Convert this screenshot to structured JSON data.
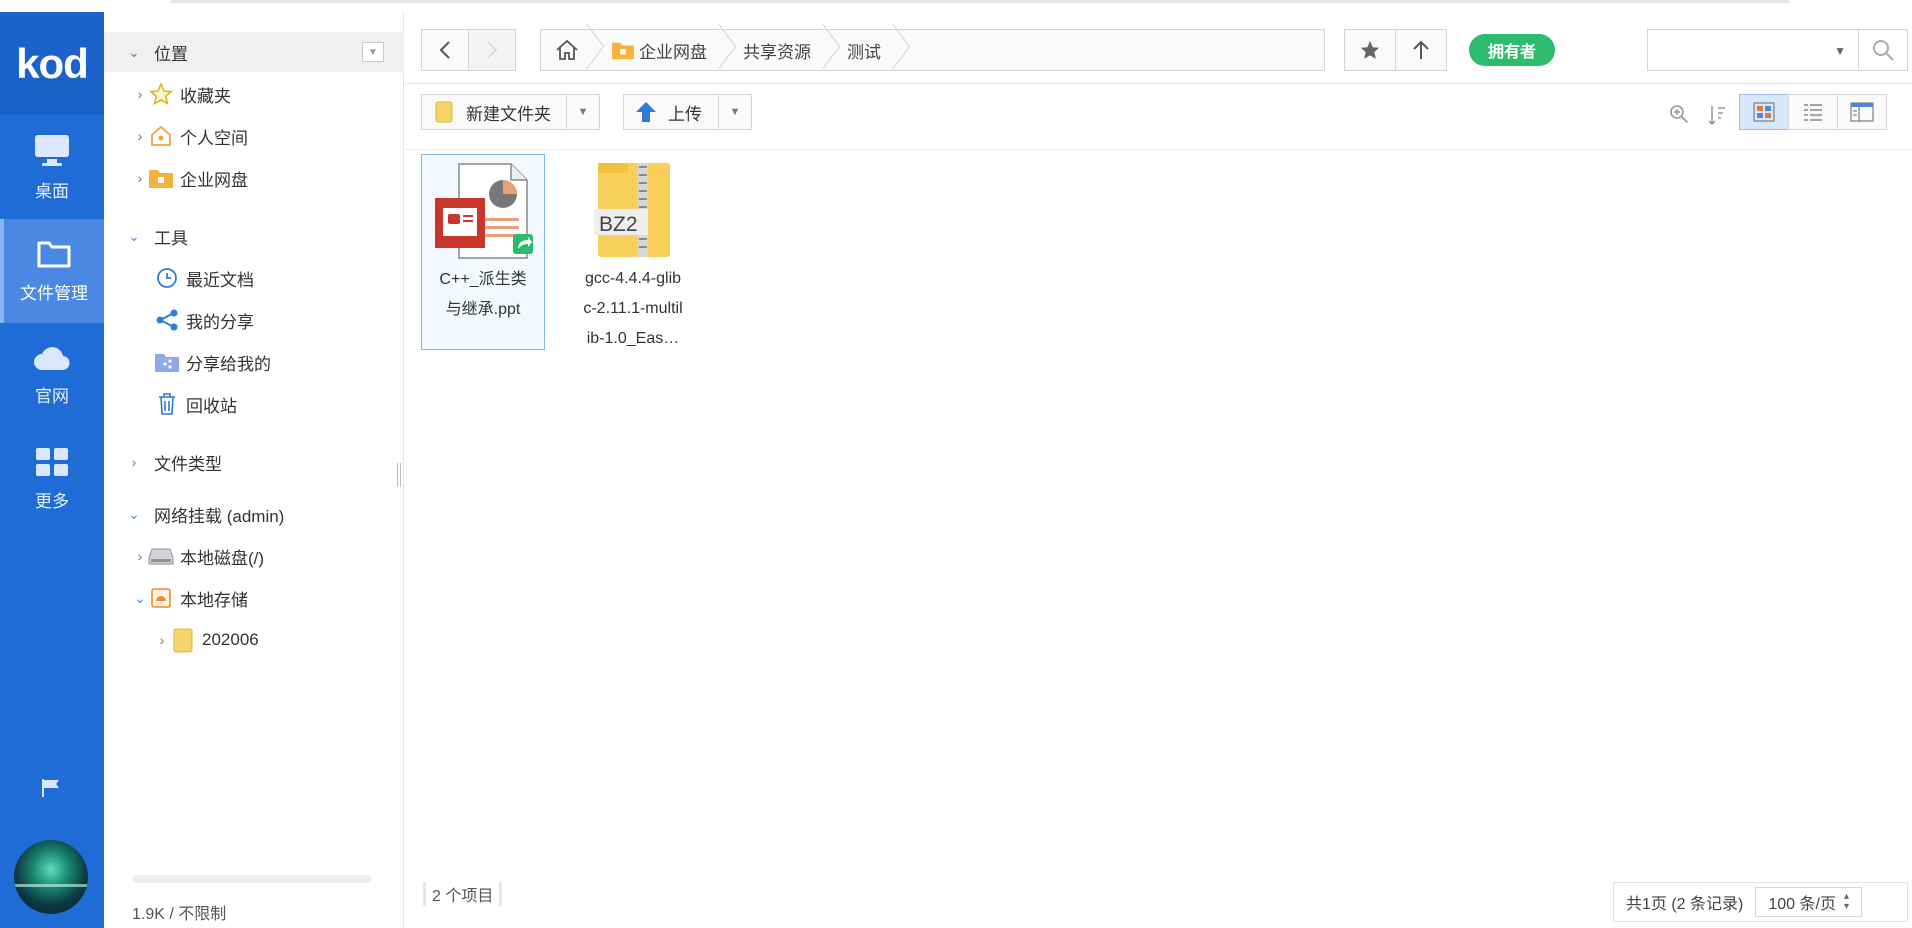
{
  "app": {
    "logo": "kod"
  },
  "leftnav": {
    "items": [
      {
        "label": "桌面",
        "icon": "monitor-icon"
      },
      {
        "label": "文件管理",
        "icon": "folder-icon",
        "active": true
      },
      {
        "label": "官网",
        "icon": "cloud-icon"
      },
      {
        "label": "更多",
        "icon": "grid-icon"
      }
    ],
    "flag_icon": "flag-icon"
  },
  "tree": {
    "location": "位置",
    "favorites": "收藏夹",
    "personal": "个人空间",
    "enterprise": "企业网盘",
    "tools": "工具",
    "recent": "最近文档",
    "myshare": "我的分享",
    "shared_to_me": "分享给我的",
    "recycle": "回收站",
    "filetypes": "文件类型",
    "network": "网络挂载 (admin)",
    "local_disk": "本地磁盘(/)",
    "local_storage": "本地存储",
    "folder_202006": "202006",
    "footer": "1.9K / 不限制"
  },
  "address": {
    "breadcrumbs": [
      "企业网盘",
      "共享资源",
      "测试"
    ],
    "owner_badge": "拥有者",
    "search_placeholder": ""
  },
  "toolbar": {
    "new_folder": "新建文件夹",
    "upload": "上传"
  },
  "files": [
    {
      "name": "C++_派生类与继承.ppt",
      "line1": "C++_派生类",
      "line2": "与继承.ppt",
      "type": "ppt",
      "selected": true
    },
    {
      "name": "gcc-4.4.4-glibc-2.11.1-multilib-1.0_Eas…",
      "line1": "gcc-4.4.4-glib",
      "line2": "c-2.11.1-multil",
      "line3": "ib-1.0_Eas…",
      "type": "bz2",
      "badge": "BZ2"
    }
  ],
  "status": {
    "count": "2 个项目"
  },
  "pager": {
    "info": "共1页 (2 条记录)",
    "per_page": "100 条/页"
  },
  "colors": {
    "nav": "#1f6cd7",
    "nav_active": "#4a88e3",
    "badge": "#2dbb6e",
    "selection": "#7fb7ea"
  }
}
